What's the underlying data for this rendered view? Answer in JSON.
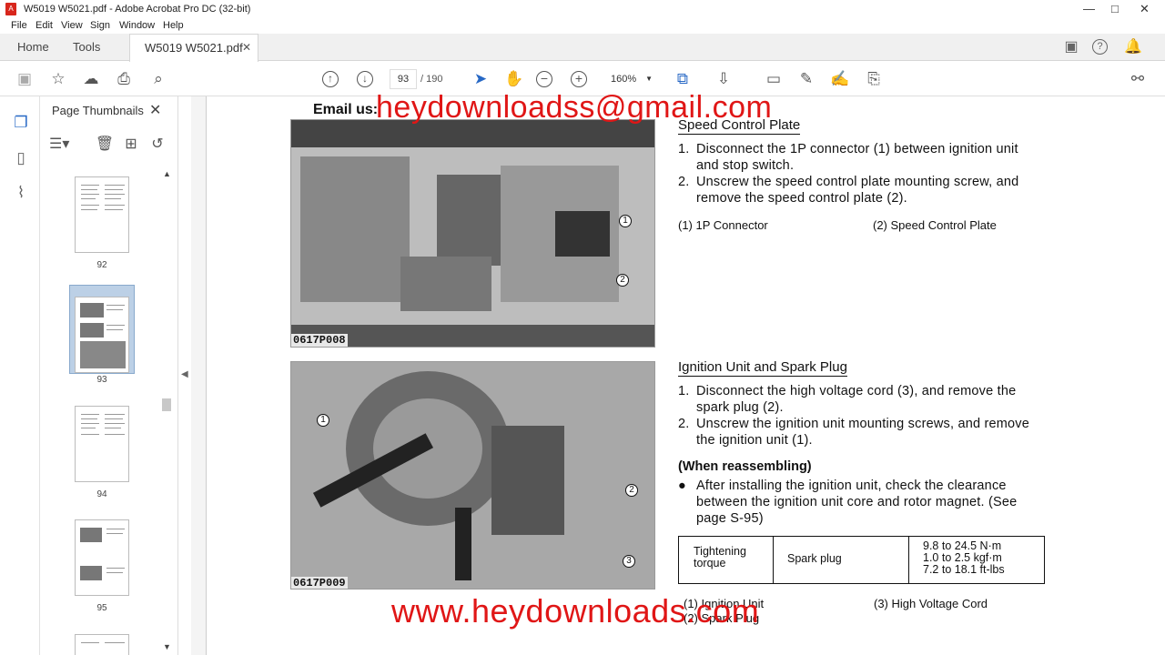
{
  "window": {
    "title": "W5019 W5021.pdf - Adobe Acrobat Pro DC (32-bit)",
    "controls": [
      "—",
      "□",
      "✕"
    ]
  },
  "menu": [
    "File",
    "Edit",
    "View",
    "Sign",
    "Window",
    "Help"
  ],
  "tabs": {
    "home": "Home",
    "tools": "Tools",
    "document": "W5019 W5021.pdf"
  },
  "toolbar": {
    "page_current": "93",
    "page_total": "/ 190",
    "zoom": "160%"
  },
  "thumbnails": {
    "header": "Page Thumbnails",
    "pages": [
      "92",
      "93",
      "94",
      "95"
    ],
    "selected": "93"
  },
  "document": {
    "email_label": "Email us:",
    "email_watermark": "heydownloadss@gmail.com",
    "url_watermark": "www.heydownloads.com",
    "section1": {
      "title": "Speed Control Plate",
      "steps": [
        {
          "n": "1.",
          "text": "Disconnect the 1P connector (1) between ignition unit and stop switch."
        },
        {
          "n": "2.",
          "text": "Unscrew the speed control plate mounting screw, and remove the speed control plate (2)."
        }
      ],
      "legend": [
        "(1)   1P Connector",
        "(2)   Speed Control Plate"
      ],
      "photo_caption": "0617P008",
      "callouts": [
        "1",
        "2"
      ]
    },
    "section2": {
      "title": "Ignition Unit and Spark Plug",
      "steps": [
        {
          "n": "1.",
          "text": "Disconnect the high voltage cord (3), and remove the spark plug (2)."
        },
        {
          "n": "2.",
          "text": "Unscrew the ignition unit mounting screws, and remove the ignition unit (1)."
        }
      ],
      "reassembling_title": "(When reassembling)",
      "bullet": "After installing the ignition unit, check the clearance between the ignition unit core and rotor magnet. (See page S-95)",
      "photo_caption": "0617P009",
      "callouts": [
        "1",
        "2",
        "3"
      ],
      "spec": {
        "label": "Tightening torque",
        "item": "Spark plug",
        "values": [
          "9.8 to 24.5 N·m",
          "1.0 to 2.5 kgf·m",
          "7.2 to 18.1 ft-lbs"
        ]
      },
      "legend": [
        "(1)   Ignition Unit",
        "(2)   Spark Plug",
        "(3)   High Voltage Cord"
      ]
    }
  }
}
